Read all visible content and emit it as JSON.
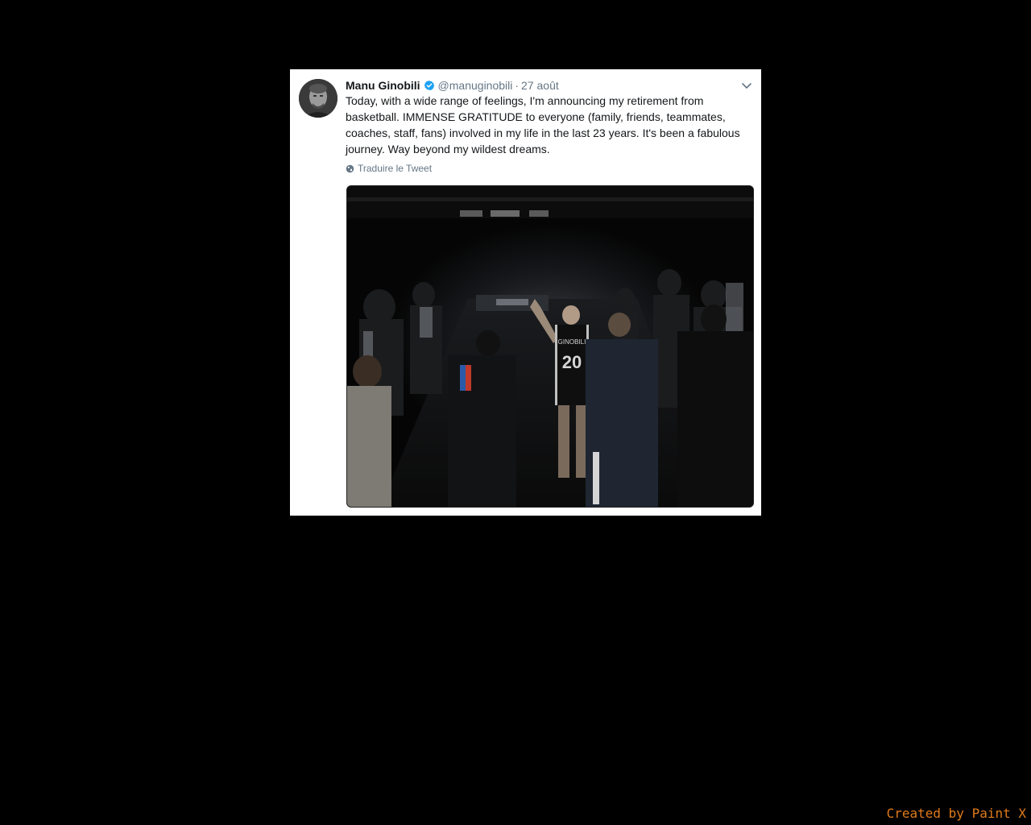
{
  "tweet": {
    "author_name": "Manu Ginobili",
    "handle": "@manuginobili",
    "separator": "·",
    "date": "27 août",
    "text": "Today, with a wide range of feelings, I'm announcing my retirement from basketball. IMMENSE GRATITUDE to everyone (family, friends, teammates, coaches, staff, fans) involved in my life in the last 23 years. It's been a fabulous journey. Way beyond my wildest dreams.",
    "translate_label": "Traduire le Tweet",
    "media": {
      "jersey_name": "GINOBILI",
      "jersey_number": "20"
    }
  },
  "overlay": {
    "credit": "Created by Paint X"
  },
  "icons": {
    "verified": "verified-badge-icon",
    "menu": "chevron-down-icon",
    "translate": "globe-icon"
  },
  "colors": {
    "verified_blue": "#1da1f2",
    "credit_orange": "#e07a1a"
  }
}
